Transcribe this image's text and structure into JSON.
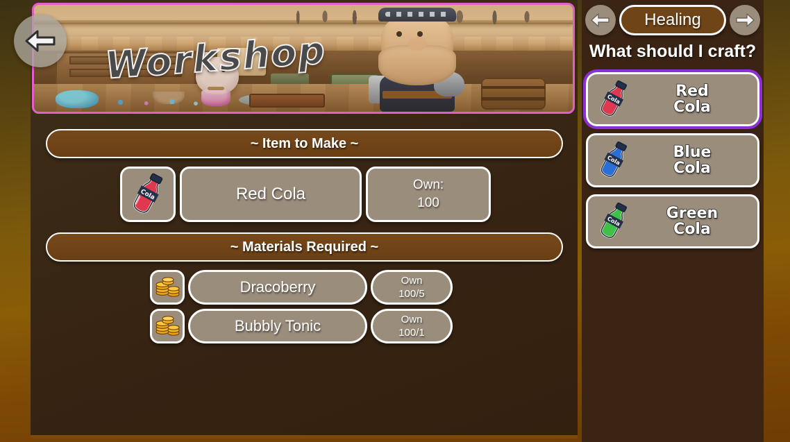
{
  "theme": {
    "page_background": "#7c5a0c",
    "panel_background": "#372312",
    "side_panel_background": "#3b2414",
    "plate_background": "#9a8d7c",
    "bar_background": "#6f4417",
    "selection_border": "#8c2fd6",
    "banner_border": "#e060c8",
    "text_color": "#ffffff"
  },
  "banner": {
    "title": "Workshop",
    "back_button_icon": "back-arrow-icon"
  },
  "main": {
    "item_section_title": "~ Item to Make ~",
    "item": {
      "icon": "red-cola-bottle-icon",
      "name": "Red Cola",
      "own_label": "Own:",
      "own_value": "100"
    },
    "materials_section_title": "~ Materials Required ~",
    "materials": [
      {
        "icon": "gold-coins-icon",
        "name": "Dracoberry",
        "own_label": "Own",
        "own_value": "100/5"
      },
      {
        "icon": "gold-coins-icon",
        "name": "Bubbly Tonic",
        "own_label": "Own",
        "own_value": "100/1"
      }
    ]
  },
  "sidebar": {
    "prev_icon": "left-arrow-icon",
    "next_icon": "right-arrow-icon",
    "category": "Healing",
    "prompt": "What should I craft?",
    "recipes": [
      {
        "icon": "red-cola-bottle-icon",
        "line1": "Red",
        "line2": "Cola",
        "selected": true
      },
      {
        "icon": "blue-cola-bottle-icon",
        "line1": "Blue",
        "line2": "Cola",
        "selected": false
      },
      {
        "icon": "green-cola-bottle-icon",
        "line1": "Green",
        "line2": "Cola",
        "selected": false
      }
    ]
  }
}
